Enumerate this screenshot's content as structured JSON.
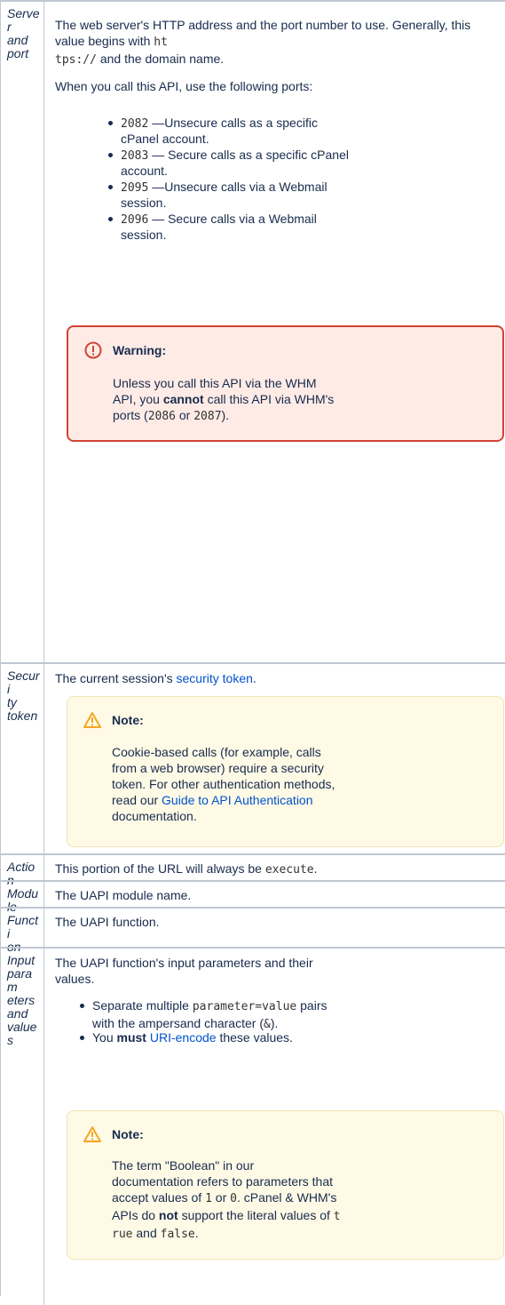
{
  "rows": [
    {
      "name": "Server and port",
      "label_lines": [
        "Server",
        "and",
        "port"
      ],
      "intro_pre": "The web server's HTTP address and the port number to use. Generally, this value begins with ",
      "intro_code_1": "ht",
      "intro_code_2": "tps://",
      "intro_post": " and the domain name.",
      "ports_intro": "When you call this API, use the following ports:",
      "ports": [
        {
          "port": "2082",
          "desc_1": " —Unsecure calls as a specific",
          "desc_2": "cPanel account."
        },
        {
          "port": "2083",
          "desc_1": " — Secure calls as a specific cPanel",
          "desc_2": "account."
        },
        {
          "port": "2095",
          "desc_1": " —Unsecure calls via a Webmail",
          "desc_2": "session."
        },
        {
          "port": "2096",
          "desc_1": " — Secure calls via a Webmail",
          "desc_2": "session."
        }
      ],
      "warning": {
        "title": "Warning:",
        "line1": "Unless you call this API via the WHM",
        "line2_pre": "API, you ",
        "line2_bold": "cannot",
        "line2_post": " call this API via WHM's",
        "line3_pre": "ports (",
        "port_a": "2086",
        "line3_mid": " or ",
        "port_b": "2087",
        "line3_post": ")."
      }
    },
    {
      "name": "Security token",
      "label_lines": [
        "Securi",
        "ty",
        "token"
      ],
      "text_pre": "The current session's ",
      "link": "security token",
      "text_post": ".",
      "note": {
        "title": "Note:",
        "line1": "Cookie-based calls (for example, calls",
        "line2": "from a web browser) require a security",
        "line3": "token. For other authentication methods,",
        "line4_pre": "read our ",
        "line4_link": "Guide to API Authentication",
        "line5": "documentation."
      }
    },
    {
      "name": "Action",
      "label_lines": [
        "Action"
      ],
      "text_pre": "This portion of the URL will always be ",
      "code": "execute",
      "text_post": "."
    },
    {
      "name": "Module",
      "label_lines": [
        "Module"
      ],
      "text": "The UAPI module name."
    },
    {
      "name": "Function",
      "label_lines": [
        "Functi",
        "on"
      ],
      "text": "The UAPI function."
    },
    {
      "name": "Input parameters and values",
      "label_lines": [
        "Input",
        "param",
        "eters",
        "and",
        "values"
      ],
      "line1": "The UAPI function's input parameters and their",
      "line2": "values.",
      "b1_pre": "Separate multiple ",
      "b1_code": "parameter=value",
      "b1_post": " pairs",
      "b1_line2_pre": "with the ampersand character (",
      "b1_amp": "&",
      "b1_line2_post": ").",
      "b2_pre": "You ",
      "b2_bold": "must",
      "b2_sp": " ",
      "b2_link": "URI-encode",
      "b2_post": " these values.",
      "note": {
        "title": "Note:",
        "line1": "The term \"Boolean\" in our",
        "line2": "documentation refers to parameters that",
        "line3_pre": "accept values of ",
        "v1": "1",
        "line3_mid": " or ",
        "v0": "0",
        "line3_post": ". cPanel & WHM's",
        "line4_pre": "APIs do ",
        "line4_bold": "not",
        "line4_mid": " support the literal values of ",
        "line4_code": "t",
        "line5_code": "rue",
        "line5_mid": " and ",
        "line5_code2": "false",
        "line5_post": "."
      }
    }
  ]
}
